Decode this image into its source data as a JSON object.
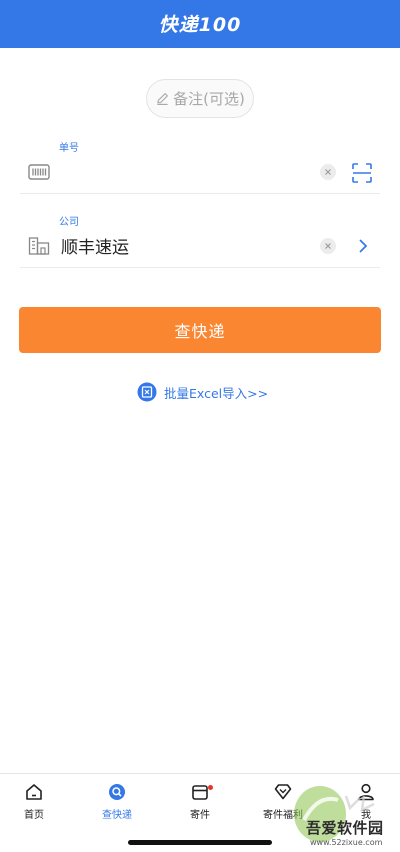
{
  "header": {
    "logo_text": "快递100",
    "color": "#3478e8"
  },
  "remark": {
    "label": "备注(可选)",
    "icon": "pencil-icon"
  },
  "tracking_field": {
    "label": "单号",
    "value": "",
    "placeholder": "",
    "icon": "barcode-icon"
  },
  "company_field": {
    "label": "公司",
    "value": "顺丰速运",
    "icon": "building-icon"
  },
  "query_button": {
    "label": "查快递",
    "color": "#fb8632"
  },
  "excel_import": {
    "label": "批量Excel导入>>",
    "icon": "excel-icon"
  },
  "tabbar": {
    "items": [
      {
        "label": "首页",
        "icon": "home-icon",
        "active": false
      },
      {
        "label": "查快递",
        "icon": "search-icon",
        "active": true
      },
      {
        "label": "寄件",
        "icon": "package-icon",
        "active": false,
        "badge": true
      },
      {
        "label": "寄件福利",
        "icon": "gift-icon",
        "active": false
      },
      {
        "label": "我",
        "icon": "profile-icon",
        "active": false
      }
    ]
  },
  "watermark": {
    "text": "吾爱软件园",
    "url": "www.52zixue.com"
  }
}
